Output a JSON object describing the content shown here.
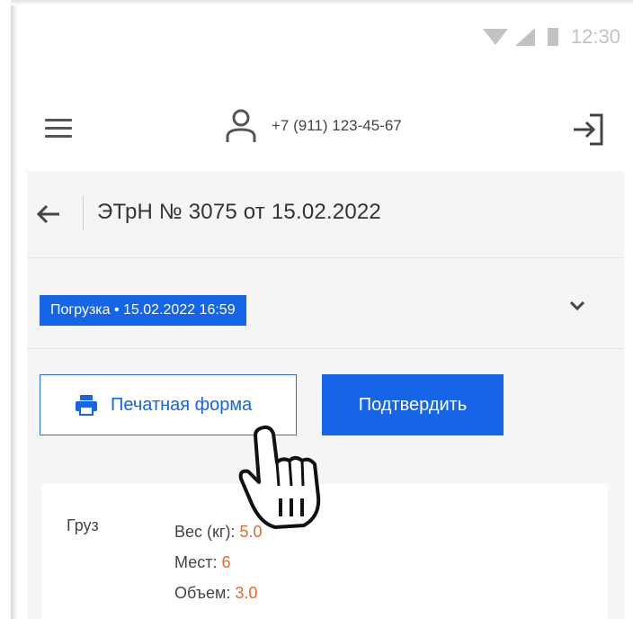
{
  "status_bar": {
    "time": "12:30"
  },
  "header": {
    "phone": "+7 (911) 123-45-67"
  },
  "document": {
    "back_icon": "arrow-left-icon",
    "title": "ЭТрН № 3075 от 15.02.2022",
    "status_badge": "Погрузка • 15.02.2022 16:59"
  },
  "actions": {
    "print_label": "Печатная форма",
    "confirm_label": "Подтвердить"
  },
  "cargo": {
    "label": "Груз",
    "weight_label": "Вес (кг):",
    "weight_value": "5.0",
    "places_label": "Мест:",
    "places_value": "6",
    "volume_label": "Объем:",
    "volume_value": "3.0"
  },
  "colors": {
    "accent": "#1565e6",
    "value": "#e8662a",
    "background": "#f5f5f6"
  }
}
